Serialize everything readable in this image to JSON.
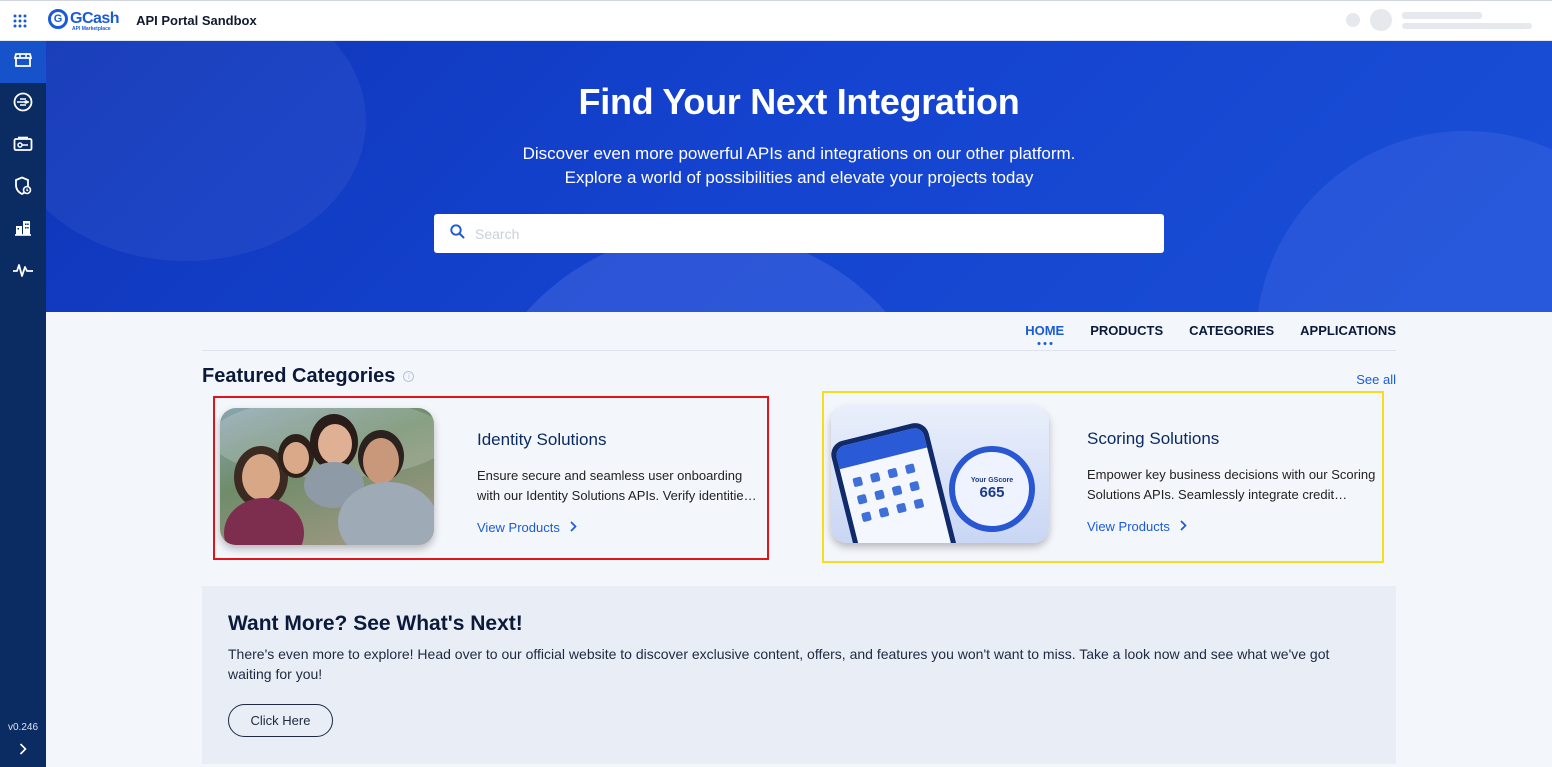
{
  "header": {
    "apps_icon": "apps-grid-icon",
    "logo_text": "GCash",
    "logo_sub": "API Marketplace",
    "portal_title": "API Portal Sandbox"
  },
  "sidebar": {
    "items": [
      {
        "icon": "storefront-icon",
        "active": true
      },
      {
        "icon": "api-icon",
        "active": false
      },
      {
        "icon": "key-card-icon",
        "active": false
      },
      {
        "icon": "security-shield-icon",
        "active": false
      },
      {
        "icon": "organization-icon",
        "active": false
      },
      {
        "icon": "activity-pulse-icon",
        "active": false
      }
    ],
    "version": "v0.246"
  },
  "hero": {
    "title": "Find Your Next Integration",
    "subtitle_line1": "Discover even more powerful APIs and integrations on our other platform.",
    "subtitle_line2": "Explore a world of possibilities and elevate your projects today",
    "search_placeholder": "Search"
  },
  "tabs": [
    {
      "label": "HOME",
      "active": true
    },
    {
      "label": "PRODUCTS",
      "active": false
    },
    {
      "label": "CATEGORIES",
      "active": false
    },
    {
      "label": "APPLICATIONS",
      "active": false
    }
  ],
  "featured": {
    "title": "Featured Categories",
    "see_all": "See all",
    "cards": [
      {
        "title": "Identity Solutions",
        "description": "Ensure secure and seamless user onboarding with our Identity Solutions APIs. Verify identities quickly and accurately.",
        "link": "View Products",
        "highlight": "#e2141b"
      },
      {
        "title": "Scoring Solutions",
        "description": "Empower key business decisions with our Scoring Solutions APIs. Seamlessly integrate credit scoring into your workflows.",
        "link": "View Products",
        "highlight": "#f6dd1d",
        "gscore_label": "Your GScore",
        "gscore_value": "665"
      }
    ]
  },
  "promo": {
    "title": "Want More? See What's Next!",
    "text": "There's even more to explore! Head over to our official website to discover exclusive content, offers, and features you won't want to miss. Take a look now and see what we've got waiting for you!",
    "button": "Click Here"
  },
  "colors": {
    "brand_blue": "#1c5bd8",
    "sidebar_bg": "#0b2b63",
    "hero_bg": "#1443cf"
  }
}
